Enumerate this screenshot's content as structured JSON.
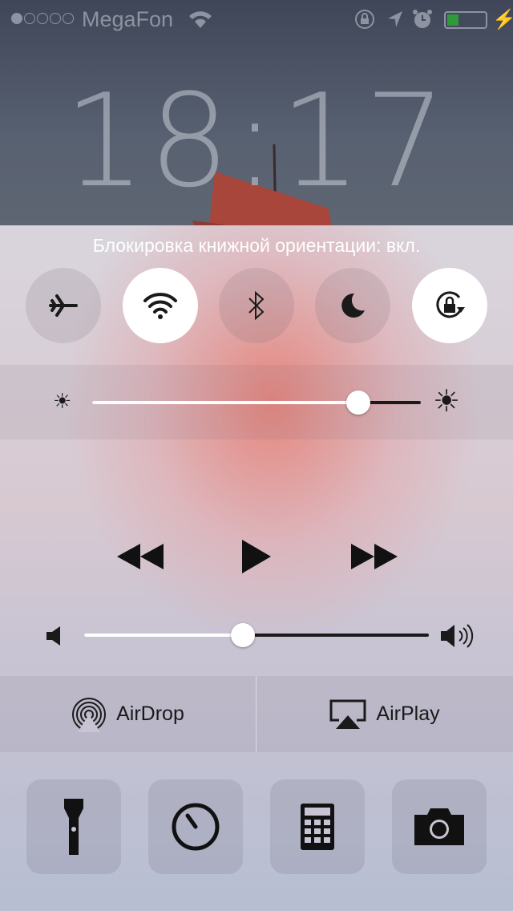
{
  "status_bar": {
    "carrier": "MegaFon",
    "signal_bars": 1,
    "signal_total": 5,
    "battery_level": 0.3,
    "battery_color": "#2e9a3a",
    "icons": [
      "wifi-icon",
      "orientation-lock-icon",
      "location-icon",
      "alarm-icon",
      "battery-icon",
      "charging-icon"
    ]
  },
  "lock_screen": {
    "time": "18:17"
  },
  "control_center": {
    "banner": "Блокировка книжной ориентации: вкл.",
    "toggles": [
      {
        "name": "airplane-mode",
        "on": false
      },
      {
        "name": "wifi",
        "on": true
      },
      {
        "name": "bluetooth",
        "on": false
      },
      {
        "name": "do-not-disturb",
        "on": false
      },
      {
        "name": "orientation-lock",
        "on": true
      }
    ],
    "brightness": 0.81,
    "media": {
      "controls": [
        "rewind",
        "play",
        "fast-forward"
      ]
    },
    "volume": 0.46,
    "airdrop_label": "AirDrop",
    "airplay_label": "AirPlay",
    "shortcuts": [
      "flashlight",
      "timer",
      "calculator",
      "camera"
    ]
  }
}
